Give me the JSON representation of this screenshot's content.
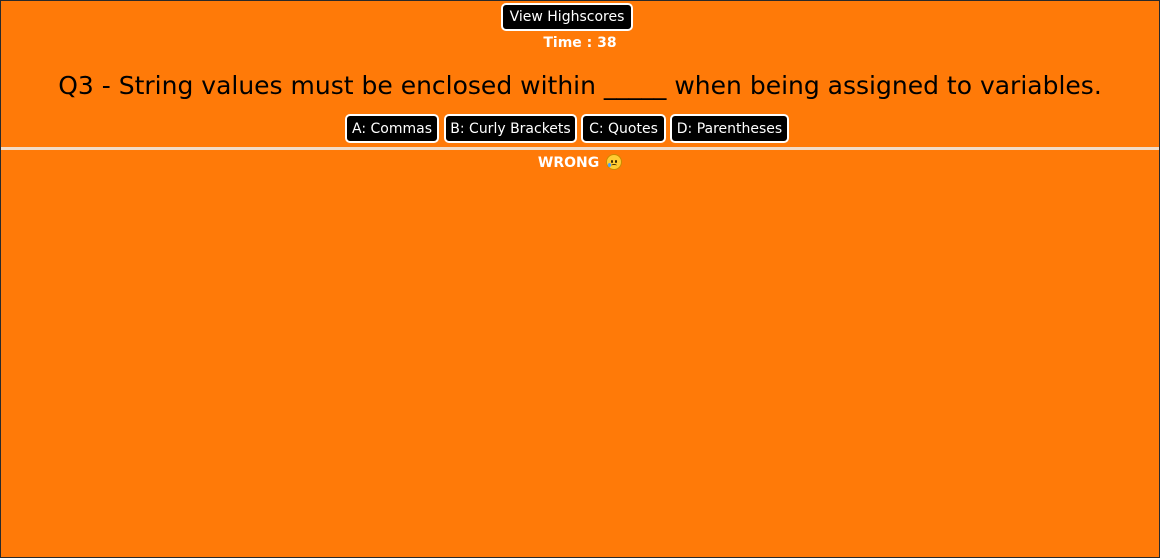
{
  "header": {
    "highscores_label": "View Highscores",
    "timer_text": "Time : 38"
  },
  "quiz": {
    "question": "Q3 - String values must be enclosed within _____ when being assigned to variables.",
    "answers": [
      {
        "label": "A: Commas"
      },
      {
        "label": "B: Curly Brackets"
      },
      {
        "label": "C: Quotes"
      },
      {
        "label": "D: Parentheses"
      }
    ],
    "feedback": "WRONG",
    "feedback_icon": "sad-tear-face-icon"
  },
  "colors": {
    "background": "#ff7a08",
    "button_bg": "#000000",
    "button_text": "#ffffff",
    "divider": "#f1dcc8"
  }
}
